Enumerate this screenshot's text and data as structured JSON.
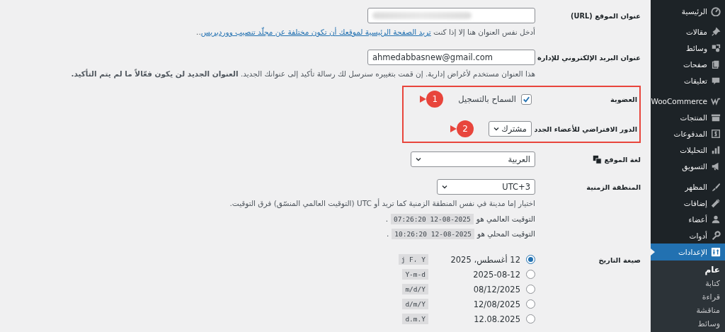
{
  "sidebar": {
    "groups": [
      {
        "items": [
          {
            "label": "الرئيسية",
            "selected": false
          }
        ]
      },
      {
        "items": [
          {
            "label": "مقالات",
            "selected": false
          },
          {
            "label": "وسائط",
            "selected": false
          },
          {
            "label": "صفحات",
            "selected": false
          },
          {
            "label": "تعليقات",
            "selected": false
          }
        ]
      },
      {
        "items": [
          {
            "label": "WooCommerce",
            "selected": false
          },
          {
            "label": "المنتجات",
            "selected": false
          },
          {
            "label": "المدفوعات",
            "selected": false
          },
          {
            "label": "التحليلات",
            "selected": false
          },
          {
            "label": "التسويق",
            "selected": false
          }
        ]
      },
      {
        "items": [
          {
            "label": "المظهر",
            "selected": false
          },
          {
            "label": "إضافات",
            "selected": false
          },
          {
            "label": "أعضاء",
            "selected": false
          },
          {
            "label": "أدوات",
            "selected": false
          },
          {
            "label": "الإعدادات",
            "selected": true,
            "children": [
              {
                "label": "عام",
                "selected": true
              },
              {
                "label": "كتابة",
                "selected": false
              },
              {
                "label": "قراءة",
                "selected": false
              },
              {
                "label": "مناقشة",
                "selected": false
              },
              {
                "label": "وسائط",
                "selected": false
              }
            ]
          }
        ]
      }
    ]
  },
  "settings": {
    "rows": [
      {
        "kind": "text",
        "label": "عنوان الموقع (URL)",
        "value_hidden": true,
        "description": {
          "before": "أدخل نفس العنوان هنا إلا إذا كنت ",
          "link": "تريد الصفحة الرئيسية لموقعك أن تكون مختلفة عن مجلّد تنصيب ووردبريس",
          "after": ".."
        }
      },
      {
        "kind": "text",
        "label": "عنوان البريد الإلكتروني للإدارة",
        "value": "ahmedabbasnew@gmail.com",
        "description": {
          "text": "هذا العنوان مستخدم لأغراض إدارية. إن قمت بتغييره سنرسل لك رسالة تأكيد إلى عنوانك الجديد. **العنوان الجديد لن يكون فعّالاً ما لم يتم التأكيد.**"
        }
      },
      {
        "kind": "highlight",
        "rows": [
          {
            "kind": "checkbox",
            "label": "العضوية",
            "option": "السماح بالتسجيل",
            "checked": true,
            "callout": "1"
          },
          {
            "kind": "role_select",
            "label": "الدور الافتراضي للأعضاء الجدد",
            "value": "مشترك",
            "callout": "2"
          }
        ]
      },
      {
        "kind": "language_select",
        "label": "لغة الموقع",
        "value": "العربية"
      },
      {
        "kind": "timezone",
        "label": "المنطقة الزمنية",
        "value": "UTC+3",
        "description": "اختيار إما مدينة في نفس المنطقة الزمنية كما تريد أو UTC (التوقيت العالمي المنسّق) فرق التوقيت.",
        "times": [
          {
            "label": "التوقيت العالمي هو",
            "value": "12-08-2025 07:26:20",
            "end": "."
          },
          {
            "label": "التوقيت المحلي هو",
            "value": "12-08-2025 10:26:20",
            "end": "."
          }
        ]
      },
      {
        "kind": "radio_group",
        "label": "صيغة التاريخ",
        "options": [
          {
            "label": "12 أغسطس، 2025",
            "format": "j F، Y",
            "selected": true
          },
          {
            "label": "2025-08-12",
            "format": "Y-m-d",
            "selected": false
          },
          {
            "label": "08/12/2025",
            "format": "m/d/Y",
            "selected": false
          },
          {
            "label": "12/08/2025",
            "format": "d/m/Y",
            "selected": false
          },
          {
            "label": "12.08.2025",
            "format": "d.m.Y",
            "selected": false
          }
        ]
      }
    ]
  }
}
